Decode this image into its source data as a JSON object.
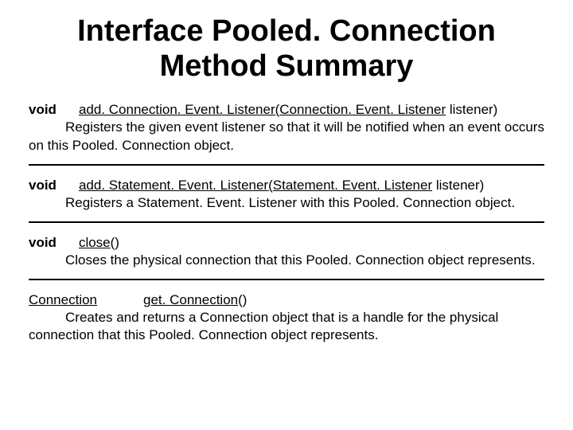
{
  "title_line1": "Interface Pooled. Connection",
  "title_line2": "Method Summary",
  "methods": [
    {
      "ret": "void",
      "name": "add. Connection. Event. Listener",
      "params_open": "(",
      "params_type": "Connection. Event. Listener",
      "params_rest": " listener)",
      "desc": "Registers the given event listener so that it will be notified when an event occurs on this Pooled. Connection object."
    },
    {
      "ret": "void",
      "name": "add. Statement. Event. Listener",
      "params_open": "(",
      "params_type": "Statement. Event. Listener",
      "params_rest": " listener)",
      "desc": "Registers a Statement. Event. Listener with this Pooled. Connection object."
    },
    {
      "ret": "void",
      "name": "close",
      "params_open": "()",
      "params_type": "",
      "params_rest": "",
      "desc": "Closes the physical connection that this Pooled. Connection object represents."
    },
    {
      "ret": "Connection",
      "name": "get. Connection",
      "params_open": "()",
      "params_type": "",
      "params_rest": "",
      "desc": "Creates and returns a Connection object that is a handle for the physical connection that this Pooled. Connection object represents."
    }
  ]
}
